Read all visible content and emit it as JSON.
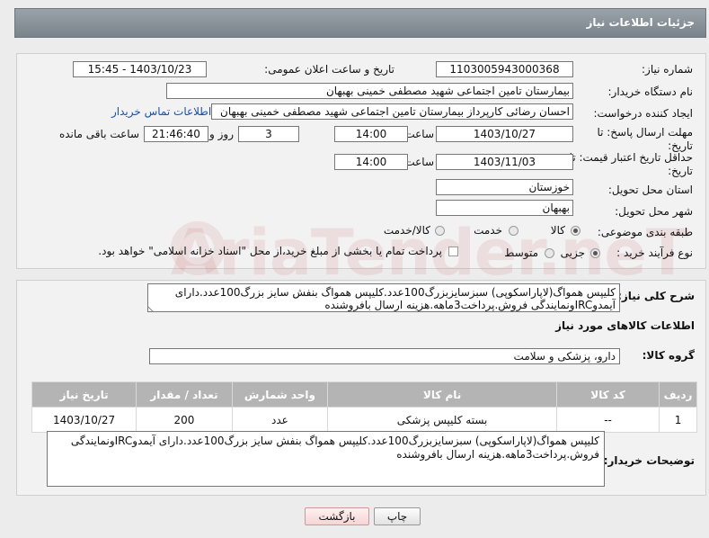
{
  "header": {
    "title": "جزئیات اطلاعات نیاز"
  },
  "fields": {
    "need_number_label": "شماره نیاز:",
    "need_number": "1103005943000368",
    "announce_label": "تاریخ و ساعت اعلان عمومی:",
    "announce_value": "1403/10/23 - 15:45",
    "buyer_label": "نام دستگاه خریدار:",
    "buyer_value": "بیمارستان تامین اجتماعی شهید مصطفی خمینی بهبهان",
    "creator_label": "ایجاد کننده درخواست:",
    "creator_value": "احسان رضائی کارپرداز بیمارستان تامین اجتماعی شهید مصطفی خمینی بهبهان",
    "contact_link": "اطلاعات تماس خریدار",
    "deadline_label_1": "مهلت ارسال پاسخ: تا",
    "deadline_label_2": "تاریخ:",
    "deadline_date": "1403/10/27",
    "time_label": "ساعت",
    "deadline_time": "14:00",
    "days_value": "3",
    "days_label": "روز و",
    "remaining_value": "21:46:40",
    "remaining_label": "ساعت باقی مانده",
    "validity_label_1": "حداقل تاریخ اعتبار قیمت: تا",
    "validity_label_2": "تاریخ:",
    "validity_date": "1403/11/03",
    "validity_time": "14:00",
    "province_label": "استان محل تحویل:",
    "province_value": "خوزستان",
    "city_label": "شهر محل تحویل:",
    "city_value": "بهبهان",
    "category_label": "طبقه بندی موضوعی:",
    "category_options": [
      "کالا",
      "خدمت",
      "کالا/خدمت"
    ],
    "process_label": "نوع فرآیند خرید :",
    "process_options": [
      "جزیی",
      "متوسط"
    ],
    "payment_note": "پرداخت تمام یا بخشی از مبلغ خرید،از محل \"اسناد خزانه اسلامی\" خواهد بود."
  },
  "description": {
    "label": "شرح کلی نیاز:",
    "value": "کلیپس همواگ(لاپاراسکوپی) سبزسایزبزرگ100عدد.کلیپس همواگ بنفش سایز بزرگ100عدد.دارای آیمدوIRCونمایندگی فروش.پرداخت3ماهه.هزینه ارسال بافروشنده"
  },
  "goods": {
    "section_title": "اطلاعات کالاهای مورد نیاز",
    "group_label": "گروه کالا:",
    "group_value": "دارو، پزشکی و سلامت",
    "columns": [
      "ردیف",
      "کد کالا",
      "نام کالا",
      "واحد شمارش",
      "تعداد / مقدار",
      "تاریخ نیاز"
    ],
    "rows": [
      {
        "row": "1",
        "code": "--",
        "name": "بسته کلیپس پزشکی",
        "unit": "عدد",
        "qty": "200",
        "date": "1403/10/27"
      }
    ]
  },
  "buyer_notes": {
    "label": "توضیحات خریدار:",
    "value": "کلیپس همواگ(لاپاراسکوپی) سبزسایزبزرگ100عدد.کلیپس همواگ بنفش سایز بزرگ100عدد.دارای آیمدوIRCونمایندگی فروش.پرداخت3ماهه.هزینه ارسال بافروشنده"
  },
  "buttons": {
    "print": "چاپ",
    "back": "بازگشت"
  },
  "watermark": "AriaTender.neT"
}
